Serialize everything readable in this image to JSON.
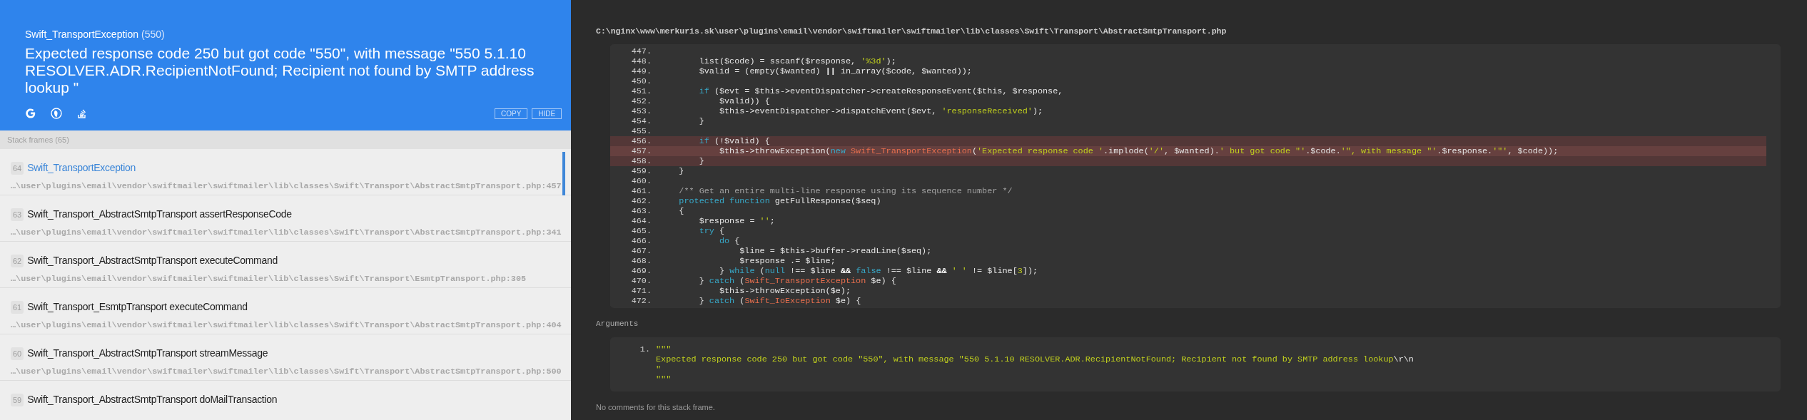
{
  "header": {
    "exception_class": "Swift_TransportException",
    "exception_code": "(550)",
    "message": "Expected response code 250 but got code \"550\", with message \"550 5.1.10 RESOLVER.ADR.RecipientNotFound; Recipient not found by SMTP address lookup \"",
    "search_links": [
      {
        "kind": "google"
      },
      {
        "kind": "duckduckgo"
      },
      {
        "kind": "stackoverflow"
      }
    ],
    "buttons": [
      "COPY",
      "HIDE"
    ]
  },
  "stack_frames": {
    "title": "Stack frames (65)",
    "frames": [
      {
        "index": "64",
        "class": "Swift_TransportException",
        "file": "…\\user\\plugins\\email\\vendor\\swiftmailer\\swiftmailer\\lib\\classes\\Swift\\Transport\\AbstractSmtpTransport.php:457",
        "selected": true
      },
      {
        "index": "63",
        "class": "Swift_Transport_AbstractSmtpTransport",
        "function": "assertResponseCode",
        "file": "…\\user\\plugins\\email\\vendor\\swiftmailer\\swiftmailer\\lib\\classes\\Swift\\Transport\\AbstractSmtpTransport.php:341",
        "selected": false
      },
      {
        "index": "62",
        "class": "Swift_Transport_AbstractSmtpTransport",
        "function": "executeCommand",
        "file": "…\\user\\plugins\\email\\vendor\\swiftmailer\\swiftmailer\\lib\\classes\\Swift\\Transport\\EsmtpTransport.php:305",
        "selected": false
      },
      {
        "index": "61",
        "class": "Swift_Transport_EsmtpTransport",
        "function": "executeCommand",
        "file": "…\\user\\plugins\\email\\vendor\\swiftmailer\\swiftmailer\\lib\\classes\\Swift\\Transport\\AbstractSmtpTransport.php:404",
        "selected": false
      },
      {
        "index": "60",
        "class": "Swift_Transport_AbstractSmtpTransport",
        "function": "streamMessage",
        "file": "…\\user\\plugins\\email\\vendor\\swiftmailer\\swiftmailer\\lib\\classes\\Swift\\Transport\\AbstractSmtpTransport.php:500",
        "selected": false
      },
      {
        "index": "59",
        "class": "Swift_Transport_AbstractSmtpTransport",
        "function": "doMailTransaction",
        "selected": false
      }
    ]
  },
  "code": {
    "file_path": "C:\\nginx\\www\\merkuris.sk\\user\\plugins\\email\\vendor\\swiftmailer\\swiftmailer\\lib\\classes\\Swift\\Transport\\AbstractSmtpTransport.php",
    "lines": [
      {
        "number": "447.",
        "in_range": false,
        "error": false
      },
      {
        "number": "448.",
        "in_range": false,
        "error": false,
        "tokens": [
          {
            "kind": "plain",
            "text": "        list($code) = sscanf($response, "
          },
          {
            "kind": "string",
            "text": "'%3d'"
          },
          {
            "kind": "plain",
            "text": ");"
          }
        ]
      },
      {
        "number": "449.",
        "in_range": false,
        "error": false,
        "tokens": [
          {
            "kind": "plain",
            "text": "        $valid = (empty($wanted) "
          },
          {
            "kind": "operator",
            "text": "||"
          },
          {
            "kind": "plain",
            "text": " in_array($code, $wanted));"
          }
        ]
      },
      {
        "number": "450.",
        "in_range": false,
        "error": false
      },
      {
        "number": "451.",
        "in_range": false,
        "error": false,
        "tokens": [
          {
            "kind": "keyword",
            "text": "        if"
          },
          {
            "kind": "plain",
            "text": " ($evt = $this->eventDispatcher->createResponseEvent($this, $response,"
          }
        ]
      },
      {
        "number": "452.",
        "in_range": false,
        "error": false,
        "tokens": [
          {
            "kind": "plain",
            "text": "            $valid)) {"
          }
        ]
      },
      {
        "number": "453.",
        "in_range": false,
        "error": false,
        "tokens": [
          {
            "kind": "plain",
            "text": "            $this->eventDispatcher->dispatchEvent($evt, "
          },
          {
            "kind": "string",
            "text": "'responseReceived'"
          },
          {
            "kind": "plain",
            "text": ");"
          }
        ]
      },
      {
        "number": "454.",
        "in_range": false,
        "error": false,
        "tokens": [
          {
            "kind": "plain",
            "text": "        }"
          }
        ]
      },
      {
        "number": "455.",
        "in_range": false,
        "error": false
      },
      {
        "number": "456.",
        "in_range": true,
        "error": false,
        "tokens": [
          {
            "kind": "keyword",
            "text": "        if"
          },
          {
            "kind": "plain",
            "text": " (!$valid) {"
          }
        ]
      },
      {
        "number": "457.",
        "in_range": true,
        "error": true,
        "tokens": [
          {
            "kind": "plain",
            "text": "            $this->throwException("
          },
          {
            "kind": "keyword",
            "text": "new "
          },
          {
            "kind": "class",
            "text": "Swift_TransportException"
          },
          {
            "kind": "plain",
            "text": "("
          },
          {
            "kind": "string",
            "text": "'Expected response code '"
          },
          {
            "kind": "plain",
            "text": ".implode("
          },
          {
            "kind": "string",
            "text": "'/'"
          },
          {
            "kind": "plain",
            "text": ", $wanted)."
          },
          {
            "kind": "string",
            "text": "' but got code \"'"
          },
          {
            "kind": "plain",
            "text": ".$code."
          },
          {
            "kind": "string",
            "text": "'\", with message \"'"
          },
          {
            "kind": "plain",
            "text": ".$response."
          },
          {
            "kind": "string",
            "text": "'\"'"
          },
          {
            "kind": "plain",
            "text": ", $code));"
          }
        ]
      },
      {
        "number": "458.",
        "in_range": true,
        "error": false,
        "tokens": [
          {
            "kind": "plain",
            "text": "        }"
          }
        ]
      },
      {
        "number": "459.",
        "in_range": false,
        "error": false,
        "tokens": [
          {
            "kind": "plain",
            "text": "    }"
          }
        ]
      },
      {
        "number": "460.",
        "in_range": false,
        "error": false
      },
      {
        "number": "461.",
        "in_range": false,
        "error": false,
        "tokens": [
          {
            "kind": "comment",
            "text": "    /** Get an entire multi-line response using its sequence number */"
          }
        ]
      },
      {
        "number": "462.",
        "in_range": false,
        "error": false,
        "tokens": [
          {
            "kind": "keyword",
            "text": "    protected function"
          },
          {
            "kind": "plain",
            "text": " getFullResponse($seq)"
          }
        ]
      },
      {
        "number": "463.",
        "in_range": false,
        "error": false,
        "tokens": [
          {
            "kind": "plain",
            "text": "    {"
          }
        ]
      },
      {
        "number": "464.",
        "in_range": false,
        "error": false,
        "tokens": [
          {
            "kind": "plain",
            "text": "        $response = "
          },
          {
            "kind": "string",
            "text": "''"
          },
          {
            "kind": "plain",
            "text": ";"
          }
        ]
      },
      {
        "number": "465.",
        "in_range": false,
        "error": false,
        "tokens": [
          {
            "kind": "keyword",
            "text": "        try"
          },
          {
            "kind": "plain",
            "text": " {"
          }
        ]
      },
      {
        "number": "466.",
        "in_range": false,
        "error": false,
        "tokens": [
          {
            "kind": "keyword",
            "text": "            do"
          },
          {
            "kind": "plain",
            "text": " {"
          }
        ]
      },
      {
        "number": "467.",
        "in_range": false,
        "error": false,
        "tokens": [
          {
            "kind": "plain",
            "text": "                $line = $this->buffer->readLine($seq);"
          }
        ]
      },
      {
        "number": "468.",
        "in_range": false,
        "error": false,
        "tokens": [
          {
            "kind": "plain",
            "text": "                $response .= $line;"
          }
        ]
      },
      {
        "number": "469.",
        "in_range": false,
        "error": false,
        "tokens": [
          {
            "kind": "plain",
            "text": "            } "
          },
          {
            "kind": "keyword",
            "text": "while"
          },
          {
            "kind": "plain",
            "text": " ("
          },
          {
            "kind": "keyword",
            "text": "null"
          },
          {
            "kind": "plain",
            "text": " !== $line "
          },
          {
            "kind": "operator",
            "text": "&&"
          },
          {
            "kind": "keyword",
            "text": " false"
          },
          {
            "kind": "plain",
            "text": " !== $line "
          },
          {
            "kind": "operator",
            "text": "&&"
          },
          {
            "kind": "string",
            "text": " ' '"
          },
          {
            "kind": "plain",
            "text": " != $line["
          },
          {
            "kind": "string",
            "text": "3"
          },
          {
            "kind": "plain",
            "text": "]);"
          }
        ]
      },
      {
        "number": "470.",
        "in_range": false,
        "error": false,
        "tokens": [
          {
            "kind": "plain",
            "text": "        } "
          },
          {
            "kind": "keyword",
            "text": "catch"
          },
          {
            "kind": "plain",
            "text": " ("
          },
          {
            "kind": "class",
            "text": "Swift_TransportException"
          },
          {
            "kind": "plain",
            "text": " $e) {"
          }
        ]
      },
      {
        "number": "471.",
        "in_range": false,
        "error": false,
        "tokens": [
          {
            "kind": "plain",
            "text": "            $this->throwException($e);"
          }
        ]
      },
      {
        "number": "472.",
        "in_range": false,
        "error": false,
        "tokens": [
          {
            "kind": "plain",
            "text": "        } "
          },
          {
            "kind": "keyword",
            "text": "catch"
          },
          {
            "kind": "plain",
            "text": " ("
          },
          {
            "kind": "class",
            "text": "Swift_IoException"
          },
          {
            "kind": "plain",
            "text": " $e) {"
          }
        ]
      }
    ]
  },
  "arguments": {
    "title": "Arguments",
    "items": [
      {
        "number": "1.",
        "lines": [
          [
            {
              "kind": "string",
              "text": "\"\"\""
            }
          ],
          [
            {
              "kind": "string",
              "text": "Expected response code 250 but got code \"550\", with message \"550 5.1.10 RESOLVER.ADR.RecipientNotFound; Recipient not found by SMTP address lookup"
            },
            {
              "kind": "escape",
              "text": "\\r\\n"
            }
          ],
          [
            {
              "kind": "string",
              "text": "\""
            }
          ],
          [
            {
              "kind": "string",
              "text": "\"\"\""
            }
          ]
        ]
      }
    ]
  },
  "comments": {
    "text": "No comments for this stack frame."
  }
}
